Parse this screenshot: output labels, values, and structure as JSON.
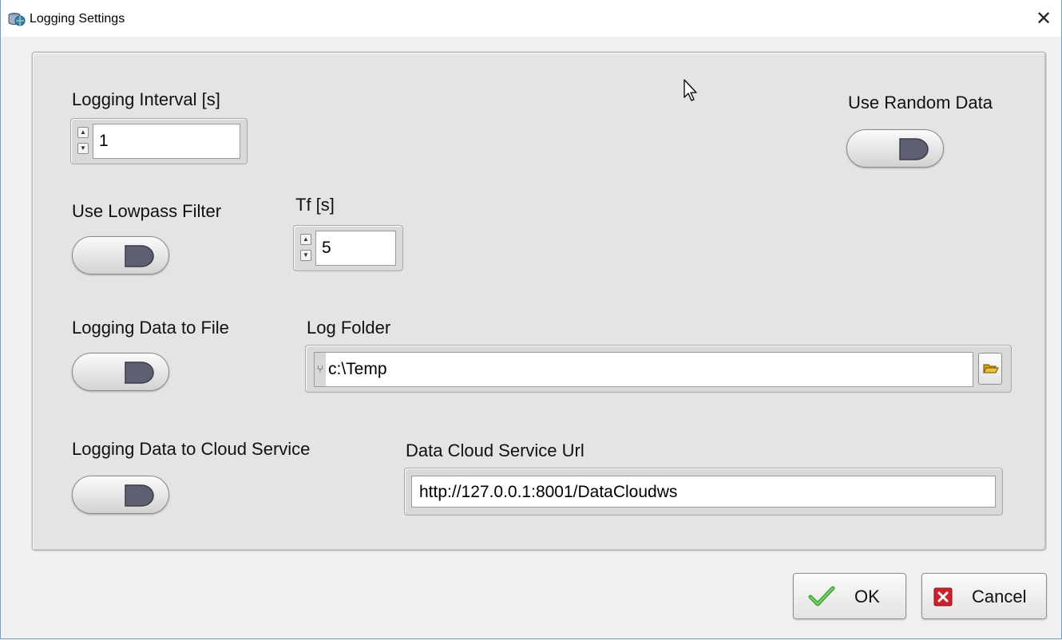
{
  "window": {
    "title": "Logging Settings",
    "close_glyph": "✕",
    "app_icon": "database-globe-icon"
  },
  "controls": {
    "logging_interval": {
      "label": "Logging Interval [s]",
      "value": "1"
    },
    "use_random_data": {
      "label": "Use Random Data",
      "state": "off"
    },
    "use_lowpass_filter": {
      "label": "Use Lowpass Filter",
      "state": "off"
    },
    "tf": {
      "label": "Tf [s]",
      "value": "5"
    },
    "logging_to_file": {
      "label": "Logging Data to File",
      "state": "off"
    },
    "log_folder": {
      "label": "Log Folder",
      "value": "c:\\Temp",
      "path_glyph": "⑂",
      "browse_icon": "folder-open-icon"
    },
    "logging_to_cloud": {
      "label": "Logging Data to Cloud Service",
      "state": "off"
    },
    "cloud_url": {
      "label": "Data Cloud Service Url",
      "value": "http://127.0.0.1:8001/DataCloudws"
    }
  },
  "buttons": {
    "ok_label": "OK",
    "cancel_label": "Cancel"
  },
  "colors": {
    "toggle_knob": "#5f5f72",
    "check_green": "#3aa832",
    "cancel_red": "#d21f2b",
    "window_border": "#6f9fcf"
  }
}
